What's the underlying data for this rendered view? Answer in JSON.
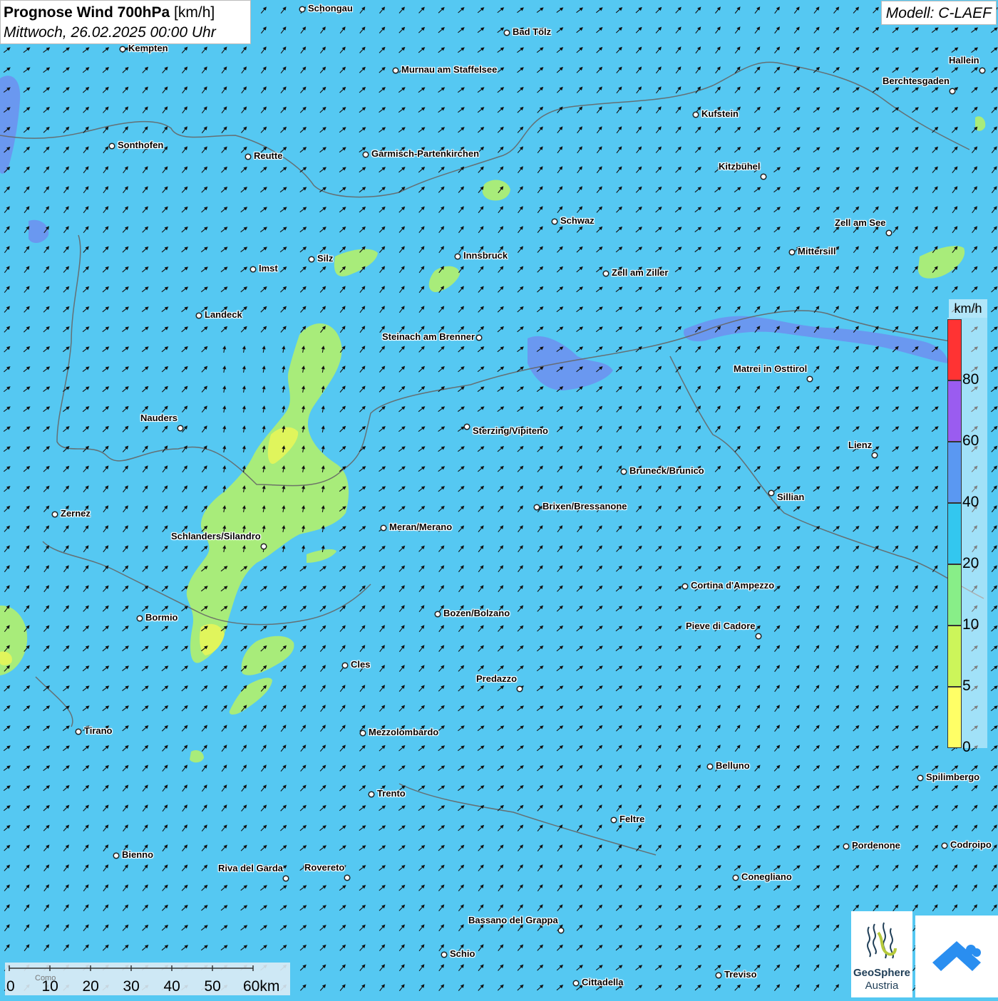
{
  "header": {
    "title_bold": "Prognose Wind 700hPa",
    "title_unit": "[km/h]",
    "date": "Mittwoch, 26.02.2025 00:00 Uhr",
    "model": "Modell: C-LAEF"
  },
  "cities": [
    "Schongau",
    "Bad Tölz",
    "Kempten",
    "Murnau am Staffelsee",
    "Hallein",
    "Berchtesgaden",
    "Kufstein",
    "Sonthofen",
    "Reutte",
    "Garmisch-Partenkirchen",
    "Kitzbühel",
    "Schwaz",
    "Zell am See",
    "Mittersill",
    "Silz",
    "Innsbruck",
    "Imst",
    "Zell am Ziller",
    "Landeck",
    "Steinach am Brenner",
    "Matrei in Osttirol",
    "Nauders",
    "Sterzing/Vipiteno",
    "Lienz",
    "Bruneck/Brunico",
    "Sillian",
    "Brixen/Bressanone",
    "Zernez",
    "Meran/Merano",
    "Schlanders/Silandro",
    "Cortina d'Ampezzo",
    "Bozen/Bolzano",
    "Bormio",
    "Pieve di Cadore",
    "Cles",
    "Predazzo",
    "Tirano",
    "Mezzolombardo",
    "Belluno",
    "Spilimbergo",
    "Trento",
    "Feltre",
    "Pordenone",
    "Codroipo",
    "Bienno",
    "Riva del Garda",
    "Rovereto",
    "Conegliano",
    "Bassano del Grappa",
    "Schio",
    "Treviso",
    "Cittadella"
  ],
  "legend": {
    "unit": "km/h",
    "classes": [
      {
        "label": "0",
        "color": "#ffff66"
      },
      {
        "label": "5",
        "color": "#ccf55a"
      },
      {
        "label": "10",
        "color": "#88ee88"
      },
      {
        "label": "20",
        "color": "#33c7ef"
      },
      {
        "label": "40",
        "color": "#5a98f2"
      },
      {
        "label": "60",
        "color": "#9a5cf0"
      },
      {
        "label": "80",
        "color": "#ff3333"
      }
    ]
  },
  "scale": {
    "labels": [
      "0",
      "10",
      "20",
      "30",
      "40",
      "50",
      "60km"
    ],
    "place_label": "Como"
  },
  "logo": {
    "name_line1": "GeoSphere",
    "name_line2": "Austria"
  },
  "colors": {
    "base_wind": "#55c8f2",
    "low_wind": "#a8ec7a",
    "very_low_wind": "#e0f55c",
    "high_wind": "#6f8ff0",
    "arrow": "#111111",
    "border": "#666666"
  },
  "icons": [
    "geosphere-logo-icon",
    "app-cloud-arrow-icon"
  ]
}
